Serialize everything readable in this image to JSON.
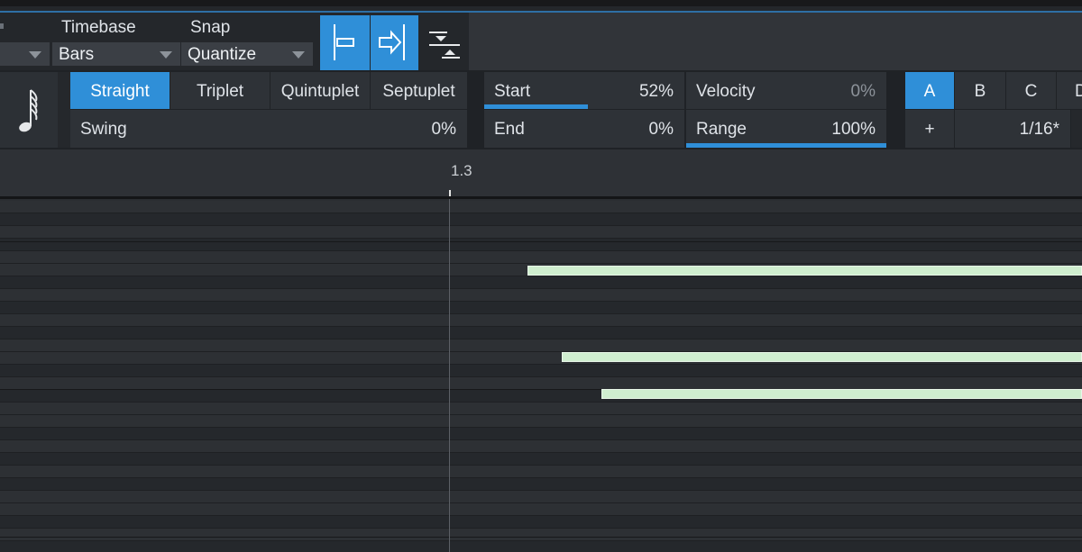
{
  "toolbar": {
    "timebase_label": "Timebase",
    "timebase_value": "Bars",
    "snap_label": "Snap",
    "snap_value": "Quantize"
  },
  "quantize": {
    "modes": [
      "Straight",
      "Triplet",
      "Quintuplet",
      "Septuplet"
    ],
    "active_mode": "Straight",
    "swing_label": "Swing",
    "swing_value": "0%",
    "start_label": "Start",
    "start_value": "52%",
    "start_level": 0.52,
    "end_label": "End",
    "end_value": "0%",
    "velocity_label": "Velocity",
    "velocity_value": "0%",
    "range_label": "Range",
    "range_value": "100%",
    "range_level": 1.0,
    "presets": [
      "A",
      "B",
      "C",
      "D"
    ],
    "active_preset": "A",
    "add_label": "+",
    "grid_value": "1/16*"
  },
  "ruler": {
    "position_label": "1.3"
  },
  "colors": {
    "accent": "#2f8fd8",
    "note": "#cfeecf"
  },
  "icons": [
    "note-value-icon",
    "align-left-icon",
    "align-right-icon",
    "quantize-icon",
    "chevron-down-icon"
  ]
}
